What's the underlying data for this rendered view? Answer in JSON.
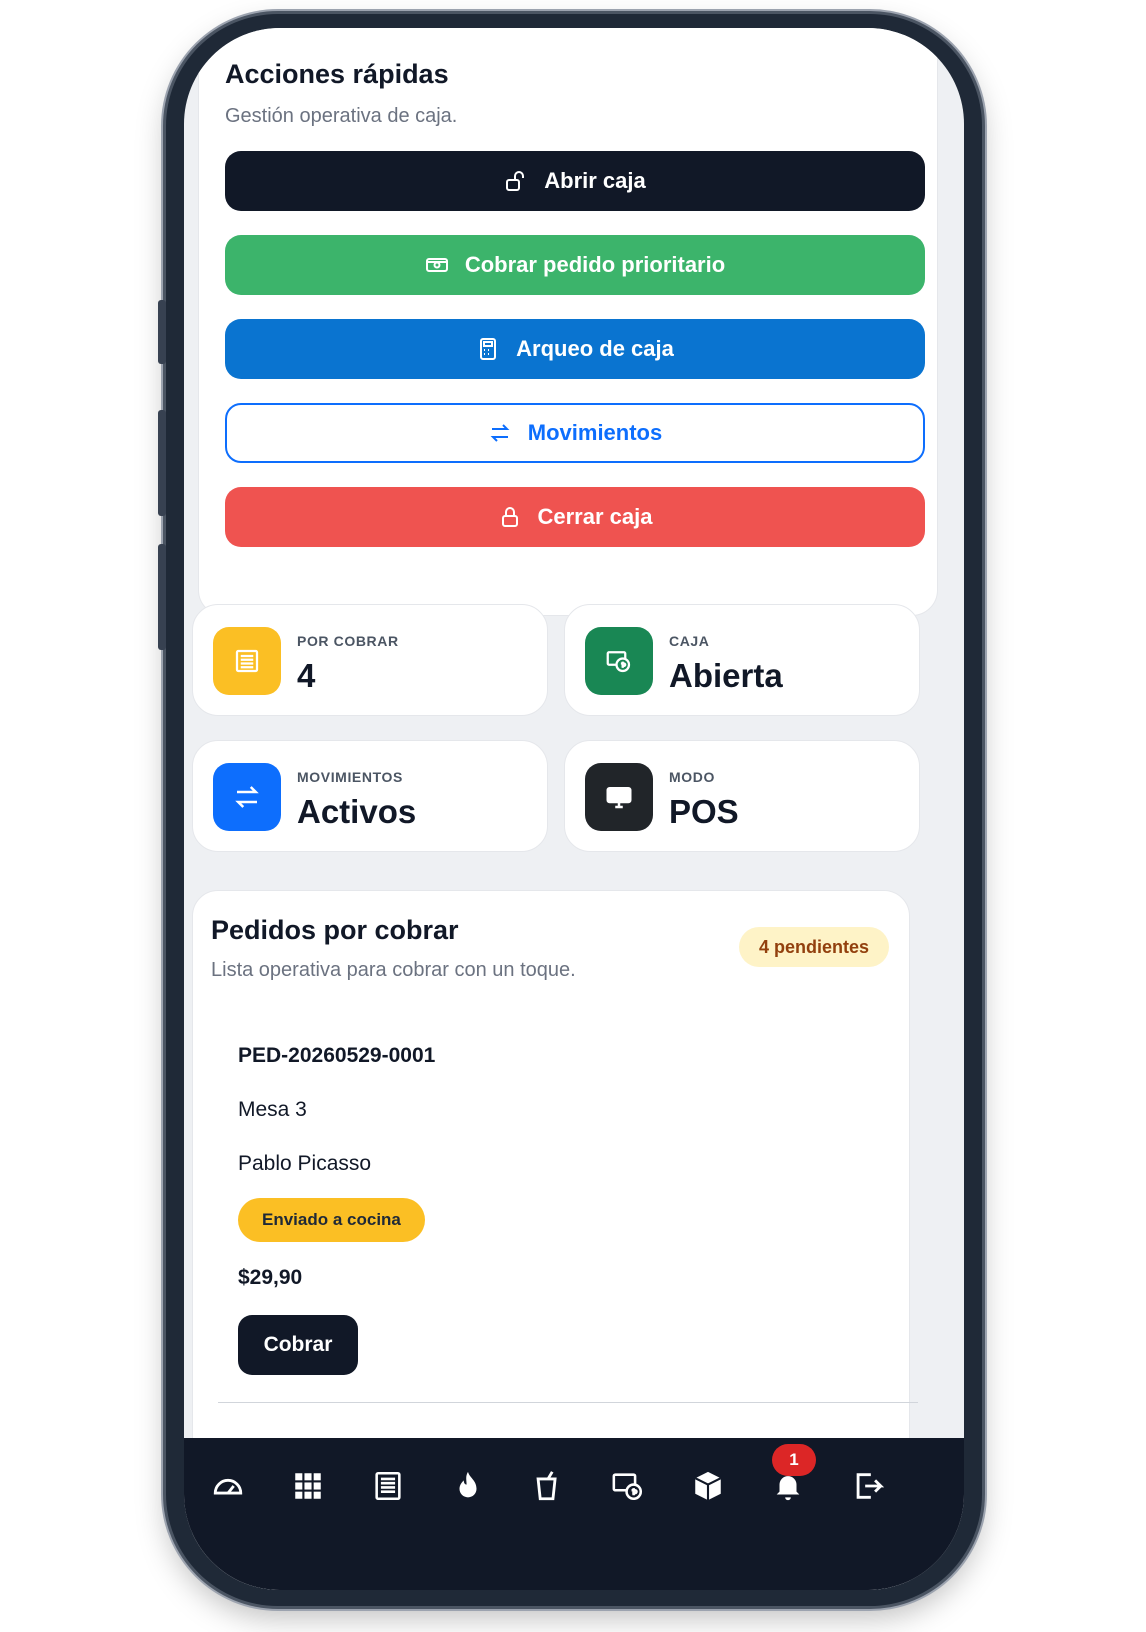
{
  "quick_actions": {
    "title": "Acciones rápidas",
    "subtitle": "Gestión operativa de caja.",
    "buttons": [
      {
        "label": "Abrir caja",
        "icon": "lock-open-icon",
        "color": "#111827"
      },
      {
        "label": "Cobrar pedido prioritario",
        "icon": "cash-icon",
        "color": "#3cb46b"
      },
      {
        "label": "Arqueo de caja",
        "icon": "calculator-icon",
        "color": "#0a74d0"
      },
      {
        "label": "Movimientos",
        "icon": "arrows-exchange-icon",
        "color": "#ffffff"
      },
      {
        "label": "Cerrar caja",
        "icon": "lock-icon",
        "color": "#ef5350"
      }
    ]
  },
  "stats": [
    {
      "label": "POR COBRAR",
      "value": "4",
      "icon": "receipt-icon",
      "color": "#fbbf24"
    },
    {
      "label": "CAJA",
      "value": "Abierta",
      "icon": "cash-register-icon",
      "color": "#198754"
    },
    {
      "label": "MOVIMIENTOS",
      "value": "Activos",
      "icon": "arrows-exchange-icon",
      "color": "#0d6efd"
    },
    {
      "label": "MODO",
      "value": "POS",
      "icon": "monitor-icon",
      "color": "#212529"
    }
  ],
  "orders": {
    "title": "Pedidos por cobrar",
    "subtitle": "Lista operativa para cobrar con un toque.",
    "badge": "4 pendientes",
    "items": [
      {
        "code": "PED-20260529-0001",
        "table": "Mesa 3",
        "customer": "Pablo Picasso",
        "status": "Enviado a cocina",
        "total": "$29,90",
        "action": "Cobrar"
      }
    ]
  },
  "nav": {
    "items": [
      "dashboard-icon",
      "grid-icon",
      "receipt-icon",
      "fire-icon",
      "cup-icon",
      "cash-register-icon",
      "box-icon",
      "bell-icon",
      "logout-icon"
    ],
    "notification_count": "1"
  }
}
